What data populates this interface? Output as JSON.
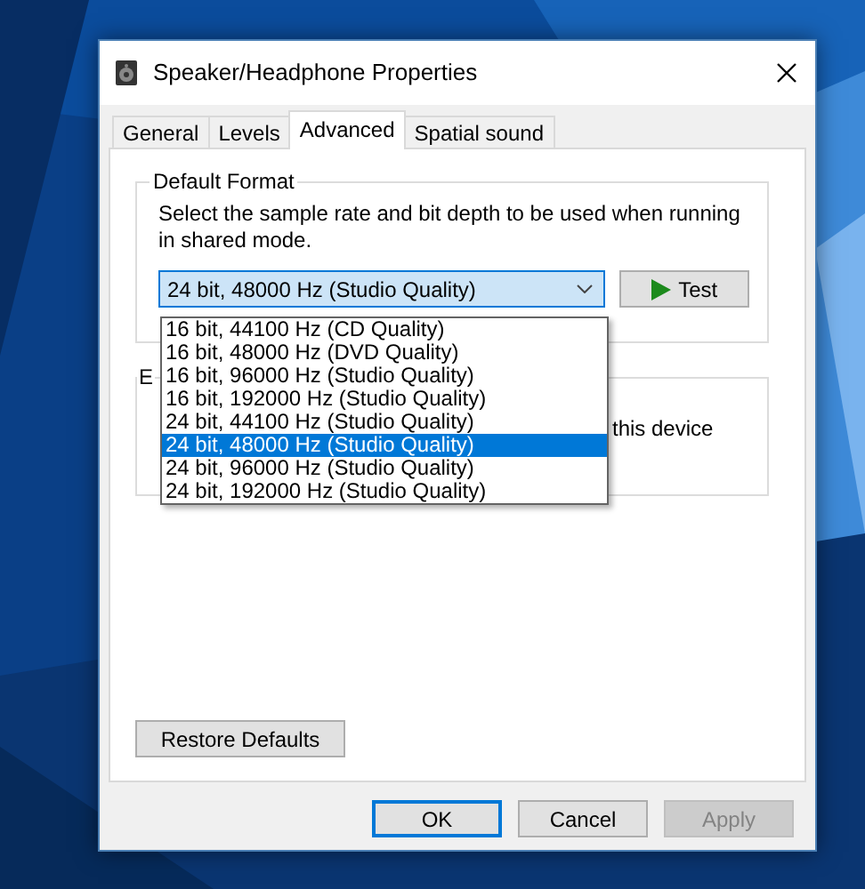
{
  "window": {
    "title": "Speaker/Headphone Properties"
  },
  "tabs": [
    {
      "label": "General",
      "selected": false
    },
    {
      "label": "Levels",
      "selected": false
    },
    {
      "label": "Advanced",
      "selected": true
    },
    {
      "label": "Spatial sound",
      "selected": false
    }
  ],
  "default_format": {
    "legend": "Default Format",
    "description": "Select the sample rate and bit depth to be used when running in shared mode.",
    "value": "24 bit, 48000 Hz (Studio Quality)",
    "expanded": true,
    "test_button": "Test",
    "options": [
      {
        "label": "16 bit, 44100 Hz (CD Quality)",
        "selected": false
      },
      {
        "label": "16 bit, 48000 Hz (DVD Quality)",
        "selected": false
      },
      {
        "label": "16 bit, 96000 Hz (Studio Quality)",
        "selected": false
      },
      {
        "label": "16 bit, 192000 Hz (Studio Quality)",
        "selected": false
      },
      {
        "label": "24 bit, 44100 Hz (Studio Quality)",
        "selected": false
      },
      {
        "label": "24 bit, 48000 Hz (Studio Quality)",
        "selected": true
      },
      {
        "label": "24 bit, 96000 Hz (Studio Quality)",
        "selected": false
      },
      {
        "label": "24 bit, 192000 Hz (Studio Quality)",
        "selected": false
      }
    ]
  },
  "exclusive_group": {
    "legend": "E",
    "text": "this device"
  },
  "restore_button": "Restore Defaults",
  "buttons": [
    {
      "label": "OK",
      "default": true,
      "disabled": false
    },
    {
      "label": "Cancel",
      "default": false,
      "disabled": false
    },
    {
      "label": "Apply",
      "default": false,
      "disabled": true
    }
  ]
}
